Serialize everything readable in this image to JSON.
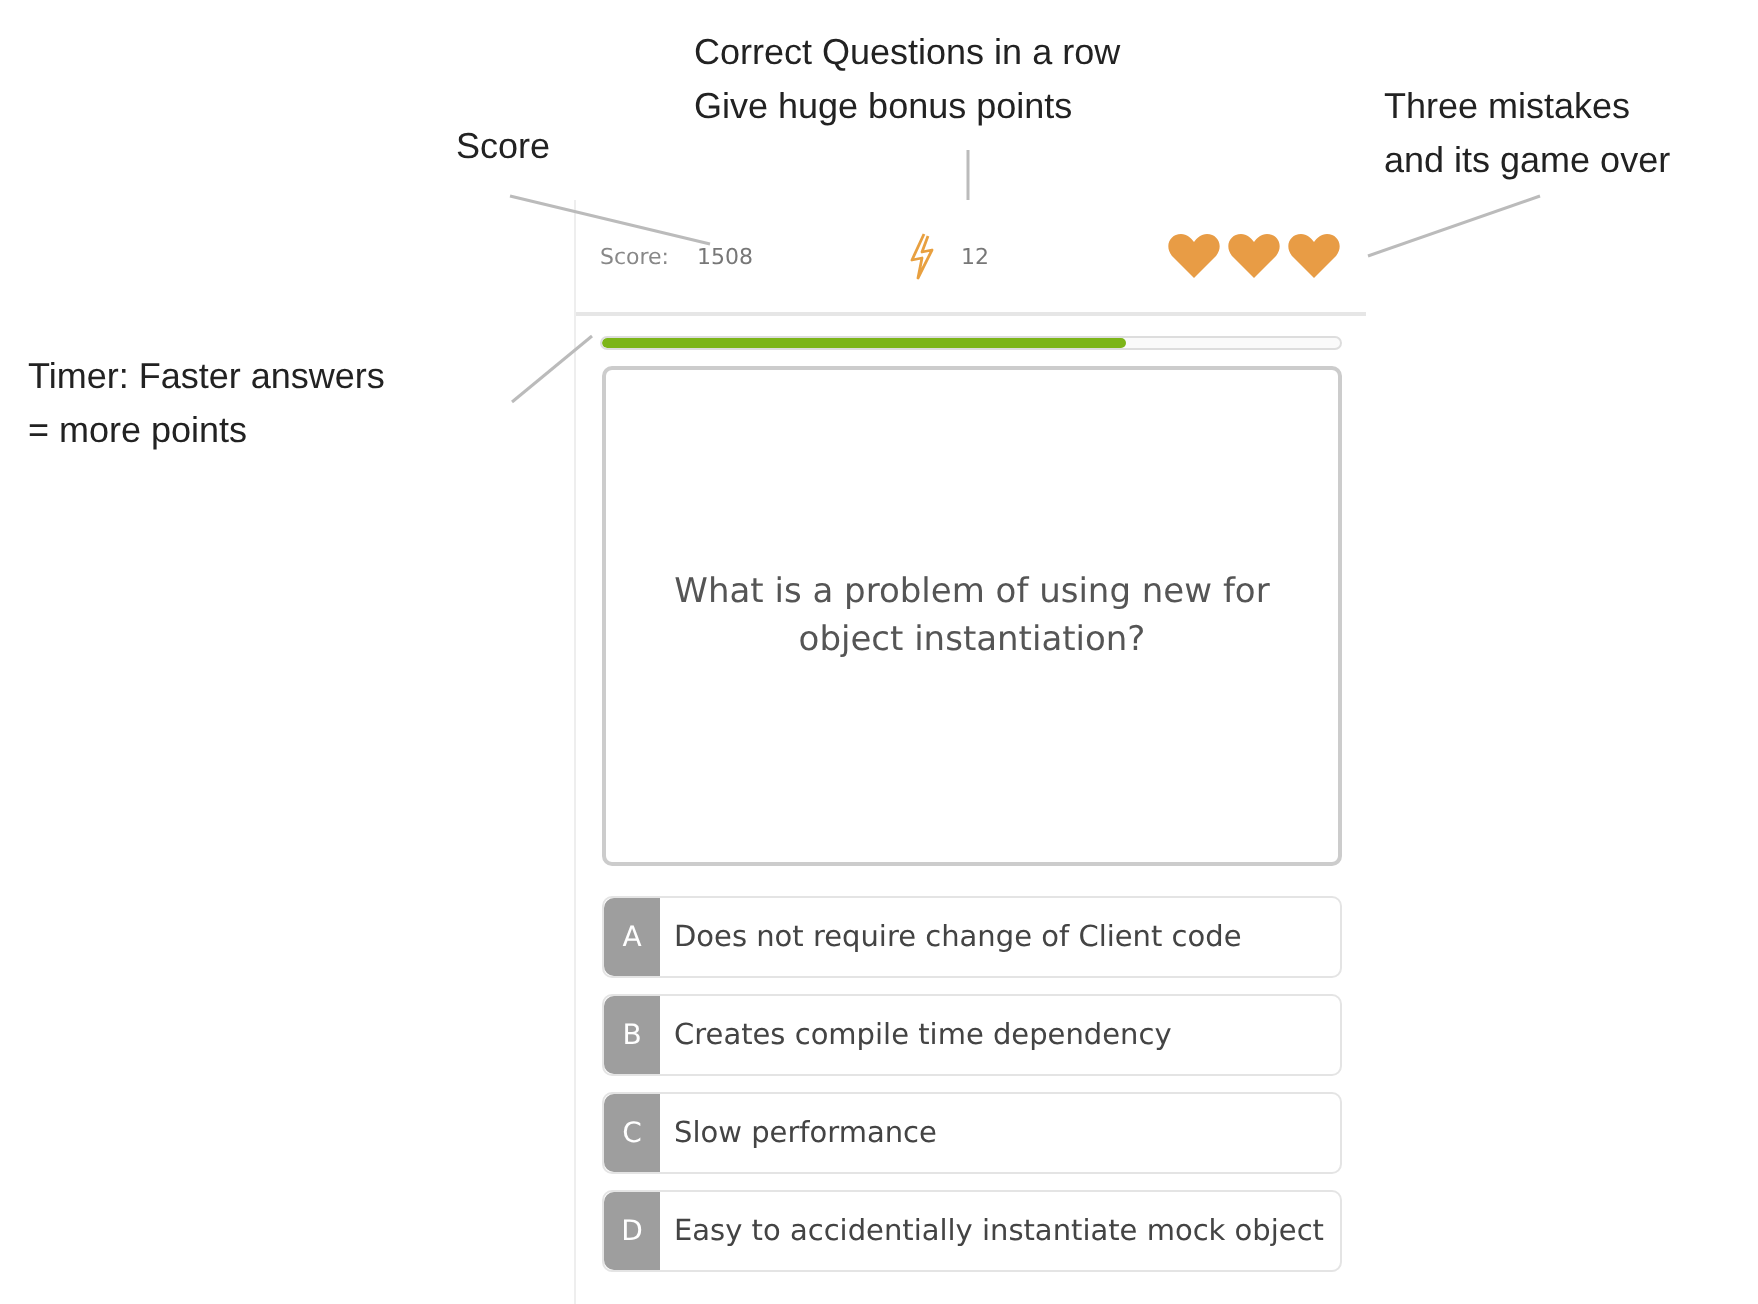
{
  "annotations": [
    {
      "text": "Score"
    },
    {
      "text": "Correct Questions in a row\nGive huge bonus points"
    },
    {
      "text": "Three mistakes\nand its game over"
    },
    {
      "text": "Timer: Faster answers\n= more points"
    }
  ],
  "header": {
    "score_label": "Score:",
    "score": "1508",
    "streak": "12",
    "lives": [
      {
        "filled": true
      },
      {
        "filled": true
      },
      {
        "filled": true
      }
    ]
  },
  "timer": {
    "level": 0.71
  },
  "question": "What is a problem of using new for object instantiation?",
  "answers": [
    {
      "letter": "A",
      "text": "Does not require change of Client code"
    },
    {
      "letter": "B",
      "text": "Creates compile time dependency"
    },
    {
      "letter": "C",
      "text": "Slow performance"
    },
    {
      "letter": "D",
      "text": "Easy to accidentially instantiate mock object"
    }
  ]
}
